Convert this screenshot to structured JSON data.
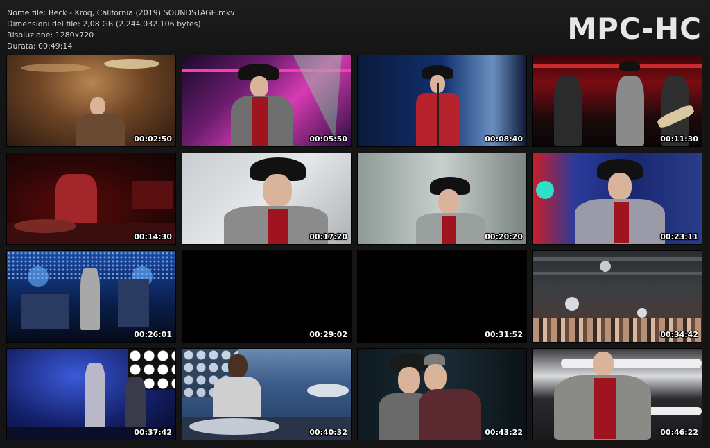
{
  "file_info": {
    "name_line": "Nome file: Beck - Kroq, California (2019) SOUNDSTAGE.mkv",
    "size_line": "Dimensioni del file: 2,08 GB (2.244.032.106 bytes)",
    "resolution_line": "Risoluzione: 1280x720",
    "duration_line": "Durata: 00:49:14"
  },
  "logo": "MPC-HC",
  "thumbnails": [
    {
      "time": "00:02:50",
      "scene": "drummer-warm-stage"
    },
    {
      "time": "00:05:50",
      "scene": "singer-pink-lights"
    },
    {
      "time": "00:08:40",
      "scene": "singer-blue-stage"
    },
    {
      "time": "00:11:30",
      "scene": "guitarists-red-stage"
    },
    {
      "time": "00:14:30",
      "scene": "drummer-red-dark"
    },
    {
      "time": "00:17:20",
      "scene": "singer-closeup-light"
    },
    {
      "time": "00:20:20",
      "scene": "singer-grey-screen"
    },
    {
      "time": "00:23:11",
      "scene": "singer-blue-red"
    },
    {
      "time": "00:26:01",
      "scene": "wide-blue-stage"
    },
    {
      "time": "00:29:02",
      "scene": "black-frame"
    },
    {
      "time": "00:31:52",
      "scene": "black-frame"
    },
    {
      "time": "00:34:42",
      "scene": "crowd-balloons"
    },
    {
      "time": "00:37:42",
      "scene": "band-blue-dots"
    },
    {
      "time": "00:40:32",
      "scene": "drummer-blue-kit"
    },
    {
      "time": "00:43:22",
      "scene": "duo-singing-dark"
    },
    {
      "time": "00:46:22",
      "scene": "singer-white-stage"
    }
  ]
}
